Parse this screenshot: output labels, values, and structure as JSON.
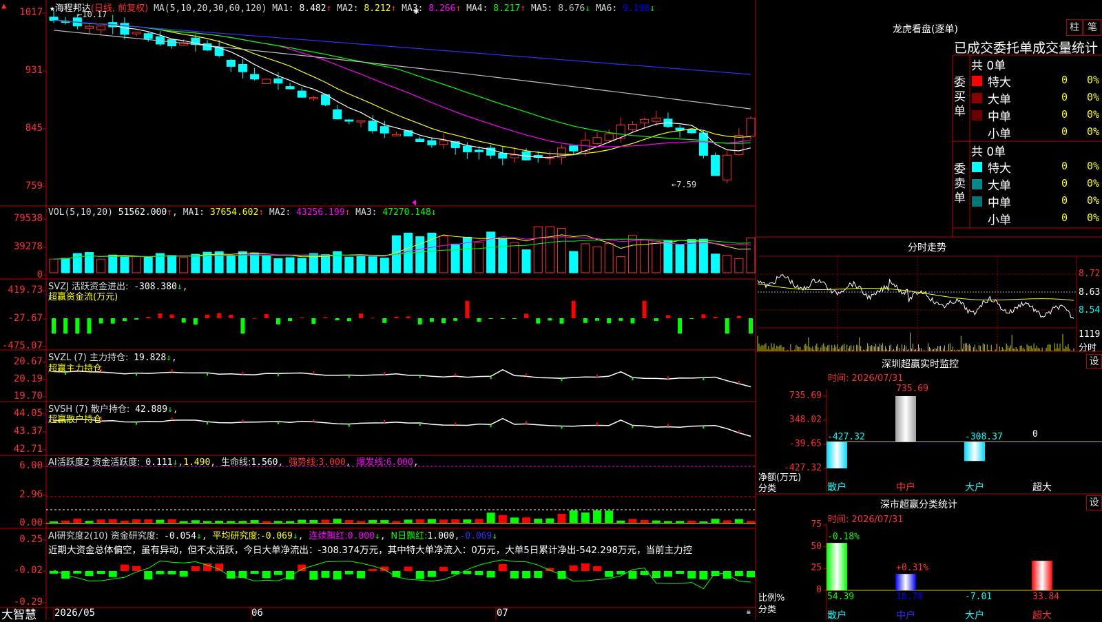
{
  "app": {
    "brand": "大智慧",
    "lock_icon": "lock-icon"
  },
  "stock": {
    "name": "海程邦达",
    "mode": "(日线, 前复权)",
    "ma_head": "MA(5,10,20,30,60,120)",
    "ma_values": [
      {
        "label": "MA1:",
        "value": "8.482",
        "trend": "↑",
        "color": "#ffffff"
      },
      {
        "label": "MA2:",
        "value": "8.212",
        "trend": "↑",
        "color": "#ffff00"
      },
      {
        "label": "MA3:",
        "value": "8.266",
        "trend": "↑",
        "color": "#ff00ff"
      },
      {
        "label": "MA4:",
        "value": "8.217",
        "trend": "↑",
        "color": "#00ff00"
      },
      {
        "label": "MA5:",
        "value": "8.676",
        "trend": "↓",
        "color": "#c0c0c0"
      },
      {
        "label": "MA6:",
        "value": "9.198",
        "trend": "↓",
        "color": "#0000ff"
      }
    ],
    "price_axis": [
      "1017",
      "931",
      "845",
      "759"
    ],
    "high_label": "10.17",
    "low_label": "7.59"
  },
  "volume": {
    "head": "VOL(5,10,20)",
    "value": "51562.000",
    "ma": [
      {
        "label": "MA1:",
        "value": "37654.602",
        "trend": "↑",
        "color": "#ffff00"
      },
      {
        "label": "MA2:",
        "value": "43256.199",
        "trend": "↑",
        "color": "#ff00ff"
      },
      {
        "label": "MA3:",
        "value": "47270.148",
        "trend": "↓",
        "color": "#00ff00"
      }
    ],
    "axis": [
      "79538",
      "39278",
      "0"
    ]
  },
  "svzj": {
    "head": "SVZJ  活跃资金进出:",
    "value": "-308.380",
    "trend": "↓",
    "sub": "超赢资金流(万元)",
    "axis": [
      "419.73",
      "-27.67",
      "-475.07"
    ]
  },
  "svzl": {
    "head": "SVZL (7) 主力持仓:",
    "value": "19.828",
    "trend": "↓",
    "sub": "超赢主力持仓",
    "axis": [
      "20.67",
      "20.19",
      "19.70"
    ]
  },
  "svsh": {
    "head": "SVSH (7) 散户持仓:",
    "value": "42.889",
    "trend": "↓",
    "sub": "超赢散户持仓",
    "axis": [
      "44.05",
      "43.37",
      "42.71"
    ]
  },
  "ai_active": {
    "head": "AI活跃度2 资金活跃度:",
    "v1": "0.111",
    "t1": "↓",
    "v2": "1.490",
    "life_label": "生命线:",
    "life_value": "1.560",
    "strong_label": "强势线:",
    "strong_value": "3.000",
    "burst_label": "爆发线:",
    "burst_value": "6.000",
    "axis": [
      "6.00",
      "2.96",
      "0.00"
    ]
  },
  "ai_research": {
    "head": "AI研究度2(10) 资金研究度:",
    "v1": "-0.054",
    "avg_label": "平均研究度:",
    "avg_value": "-0.069",
    "red_label": "连续飘红:",
    "red_value": "0.000",
    "nred_label": "N日飘红:",
    "nred_value": "1.000",
    "last_value": "-0.069",
    "desc": "近期大资金总体偏空，虽有异动，但不太活跃，今日大单净流出：-308.374万元，其中特大单净流入：0万元，大单5日累计净出-542.298万元，当前主力控",
    "axis": [
      "0.25",
      "-0.02",
      "-0.29"
    ]
  },
  "time_axis": [
    "2026/05",
    "06",
    "07"
  ],
  "right": {
    "panel_title": "龙虎看盘(逐单)",
    "btn_bar": "柱",
    "btn_pen": "笔",
    "stat_title": "已成交委托单成交量统计",
    "buy": {
      "side": "委买单",
      "total": "共 0单",
      "rows": [
        {
          "name": "特大",
          "count": "0",
          "pct": "0%",
          "color": "#ff0000"
        },
        {
          "name": "大单",
          "count": "0",
          "pct": "0%",
          "color": "#8b0000"
        },
        {
          "name": "中单",
          "count": "0",
          "pct": "0%",
          "color": "#6b0000"
        },
        {
          "name": "小单",
          "count": "0",
          "pct": "0%",
          "color": ""
        }
      ]
    },
    "sell": {
      "side": "委卖单",
      "total": "共 0单",
      "rows": [
        {
          "name": "特大",
          "count": "0",
          "pct": "0%",
          "color": "#00ffff"
        },
        {
          "name": "大单",
          "count": "0",
          "pct": "0%",
          "color": "#008b8b"
        },
        {
          "name": "中单",
          "count": "0",
          "pct": "0%",
          "color": "#007777"
        },
        {
          "name": "小单",
          "count": "0",
          "pct": "0%",
          "color": ""
        }
      ]
    },
    "intraday": {
      "title": "分时走势",
      "axis": [
        "8.72",
        "8.63",
        "8.54"
      ],
      "vol_max": "1119",
      "unit": "分时"
    },
    "monitor": {
      "title": "深圳超赢实时监控",
      "btn": "设",
      "time_label": "时间:",
      "time_value": "2026/07/31",
      "axis": [
        "735.69",
        "348.02",
        "-39.65",
        "-427.32"
      ],
      "y_label": "净额(万元)",
      "x_label": "分类",
      "categories": [
        "散户",
        "中户",
        "大户",
        "超大"
      ],
      "values": [
        -427.32,
        735.69,
        -308.37,
        0
      ],
      "value_labels": [
        "-427.32",
        "735.69",
        "-308.37",
        "0"
      ]
    },
    "classify": {
      "title": "深市超赢分类统计",
      "btn": "设",
      "time_label": "时间:",
      "time_value": "2026/07/31",
      "axis": [
        "75",
        "50",
        "25",
        "0"
      ],
      "y_label": "比例%",
      "x_label": "分类",
      "categories": [
        "散户",
        "中户",
        "大户",
        "超大"
      ],
      "values": [
        54.39,
        18.78,
        -7.01,
        33.84
      ],
      "changes": [
        "-0.18%",
        "+0.31%",
        "",
        ""
      ]
    }
  },
  "chart_data": {
    "type": "bar",
    "title": "深圳超赢实时监控",
    "xlabel": "分类",
    "ylabel": "净额(万元)",
    "categories": [
      "散户",
      "中户",
      "大户",
      "超大"
    ],
    "values": [
      -427.32,
      735.69,
      -308.37,
      0
    ],
    "ylim": [
      -427.32,
      735.69
    ]
  }
}
